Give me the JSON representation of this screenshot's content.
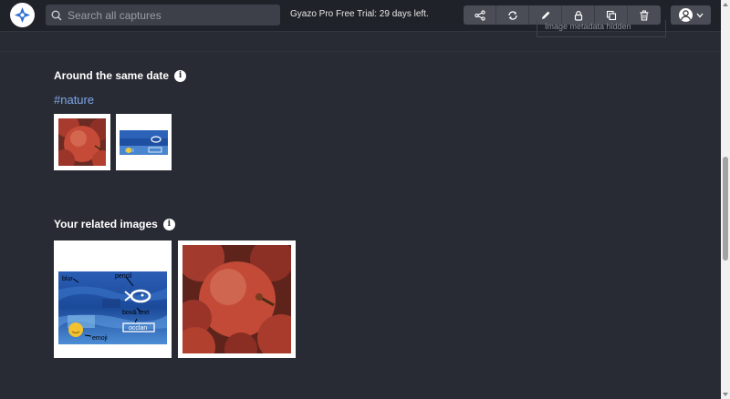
{
  "header": {
    "search_placeholder": "Search all captures",
    "trial_text": "Gyazo Pro Free Trial: 29 days left.",
    "toolbar": [
      "share-icon",
      "sync-icon",
      "pencil-icon",
      "lock-icon",
      "copy-icon",
      "trash-icon"
    ]
  },
  "metadata": {
    "hidden_label": "Image metadata hidden"
  },
  "same_date": {
    "title": "Around the same date",
    "tag": "#nature"
  },
  "related": {
    "title": "Your related images"
  },
  "thumb_annotations": {
    "blur": "blur",
    "pencil": "pencil",
    "box_text": "box& text",
    "occlan": "occlan",
    "emoji": "emoji"
  },
  "colors": {
    "background": "#282b33",
    "header": "#1f2228",
    "tag": "#7fa7e9",
    "accent": "#2f6fd1"
  }
}
